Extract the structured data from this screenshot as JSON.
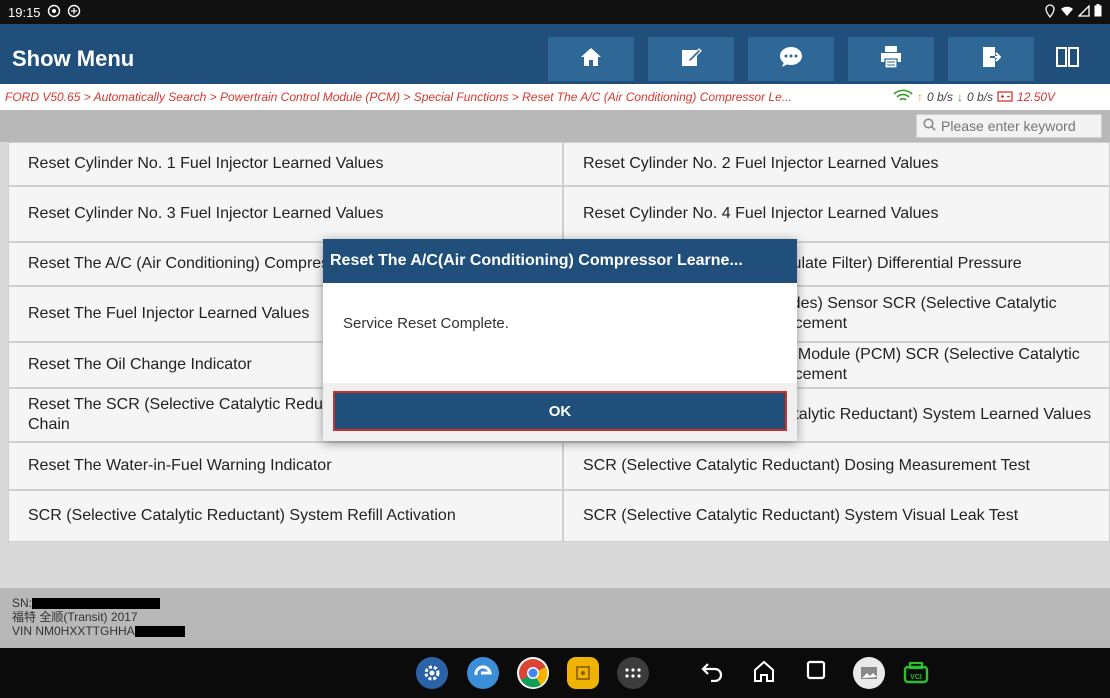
{
  "status_bar": {
    "time": "19:15"
  },
  "toolbar": {
    "title": "Show Menu",
    "buttons": [
      "home-icon",
      "edit-icon",
      "chat-icon",
      "print-icon",
      "exit-icon",
      "split-icon"
    ]
  },
  "breadcrumb": {
    "text": "FORD V50.65 > Automatically Search > Powertrain Control Module (PCM) > Special Functions > Reset The A/C (Air Conditioning) Compressor Le...",
    "upload": "0 b/s",
    "download": "0 b/s",
    "voltage": "12.50V"
  },
  "search": {
    "placeholder": "Please enter keyword"
  },
  "menu": {
    "items": [
      "Reset Cylinder No. 1 Fuel Injector Learned Values",
      "Reset Cylinder No. 2 Fuel Injector Learned Values",
      "Reset Cylinder No. 3 Fuel Injector Learned Values",
      "Reset Cylinder No. 4 Fuel Injector Learned Values",
      "Reset The A/C (Air Conditioning) Compressor Learned Values",
      "Reset The DPF (Diesel Particulate Filter) Differential Pressure",
      "Reset The Fuel Injector Learned Values",
      "Reset The NOx (Nitrogen Oxides) Sensor SCR (Selective Catalytic Reductant) System Fault Inducement",
      "Reset The Oil Change Indicator",
      "Reset The Powertrain Control Module (PCM) SCR (Selective Catalytic Reductant) System Fault Inducement",
      "Reset The SCR (Selective Catalytic Reductant) System Fault Inducement Chain",
      "Reset The SCR (Selective Catalytic Reductant) System Learned Values",
      "Reset The Water-in-Fuel Warning Indicator",
      "SCR (Selective Catalytic Reductant) Dosing Measurement Test",
      "SCR (Selective Catalytic Reductant) System Refill Activation",
      "SCR (Selective Catalytic Reductant) System Visual Leak Test"
    ]
  },
  "footer": {
    "sn_label": "SN:",
    "vehicle": "福特 全顺(Transit) 2017",
    "vin_label": "VIN NM0HXXTTGHHA"
  },
  "dialog": {
    "title": "Reset The A/C(Air Conditioning) Compressor Learne...",
    "message": "Service Reset Complete.",
    "ok_label": "OK"
  },
  "colors": {
    "header": "#1f4f7a",
    "breadcrumb": "#d6372e",
    "ok_border": "#c9312c"
  }
}
